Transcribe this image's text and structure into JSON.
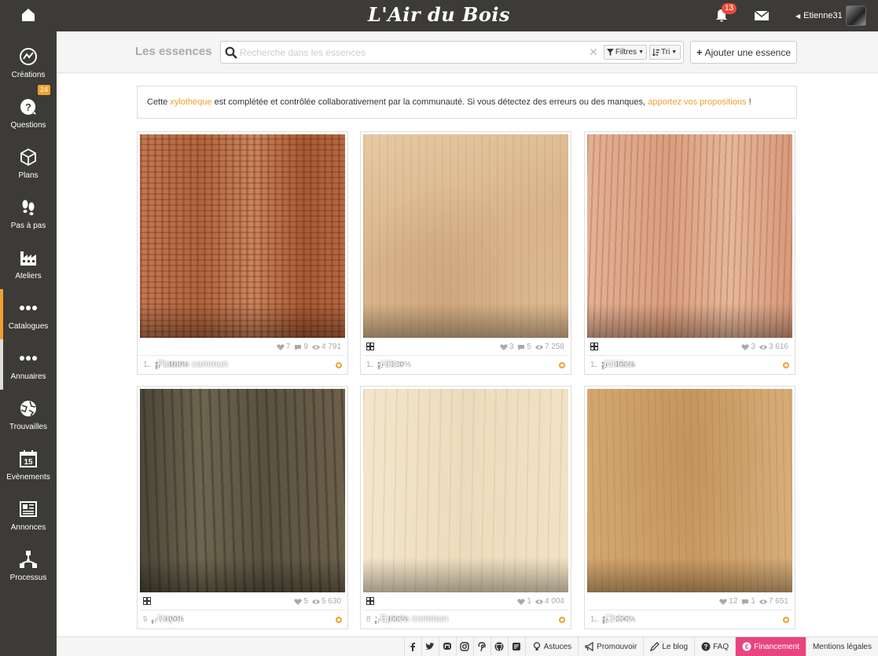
{
  "header": {
    "logo": "L'Air du Bois",
    "notifications_count": "13",
    "username": "Etienne31"
  },
  "sidebar": {
    "items": [
      {
        "label": "Créations",
        "icon": "creations-icon"
      },
      {
        "label": "Questions",
        "icon": "question-icon",
        "badge": "24"
      },
      {
        "label": "Plans",
        "icon": "cube-icon"
      },
      {
        "label": "Pas à pas",
        "icon": "footsteps-icon"
      },
      {
        "label": "Ateliers",
        "icon": "factory-icon"
      },
      {
        "label": "Catalogues",
        "icon": "dots-icon"
      },
      {
        "label": "Annuaires",
        "icon": "dots-icon"
      },
      {
        "label": "Trouvailles",
        "icon": "globe-icon"
      },
      {
        "label": "Evènements",
        "icon": "calendar-icon",
        "calendar_day": "15"
      },
      {
        "label": "Annonces",
        "icon": "newspaper-icon"
      },
      {
        "label": "Processus",
        "icon": "workflow-icon"
      }
    ]
  },
  "toolbar": {
    "title": "Les essences",
    "search_placeholder": "Recherche dans les essences",
    "filters_label": "Filtres",
    "sort_label": "Tri",
    "add_label": "Ajouter une essence"
  },
  "info": {
    "text_before": "Cette ",
    "link1": "xylothèque",
    "text_middle": " est complétée et contrôlée collaborativement par la communauté. Si vous détectez des erreurs ou des manques, ",
    "link2": "apportez vos propositions",
    "text_after": " !"
  },
  "cards": [
    {
      "name": "Platane commun",
      "tree": "deciduous",
      "likes": "7",
      "comments": "9",
      "views": "4 791",
      "has_grid": false,
      "count": "13",
      "percent": "100%",
      "texture": "platane"
    },
    {
      "name": "Hêtre",
      "tree": "deciduous",
      "likes": "3",
      "comments": "5",
      "views": "7 258",
      "has_grid": true,
      "count": "11",
      "percent": "100%",
      "texture": "hetre"
    },
    {
      "name": "Mélèze",
      "tree": "conifer",
      "likes": "3",
      "comments": "",
      "views": "3 616",
      "has_grid": true,
      "count": "11",
      "percent": "100%",
      "texture": "meleze"
    },
    {
      "name": "Noyer",
      "tree": "deciduous",
      "likes": "5",
      "comments": "",
      "views": "5 630",
      "has_grid": true,
      "count": "9",
      "percent": "100%",
      "texture": "noyer"
    },
    {
      "name": "Epicéa commun",
      "tree": "conifer",
      "likes": "1",
      "comments": "",
      "views": "4 004",
      "has_grid": true,
      "count": "8",
      "percent": "100%",
      "texture": "epicea"
    },
    {
      "name": "Chêne",
      "tree": "deciduous",
      "likes": "12",
      "comments": "1",
      "views": "7 651",
      "has_grid": false,
      "count": "12",
      "percent": "100%",
      "texture": "chene"
    }
  ],
  "footer": {
    "social": [
      "facebook-icon",
      "twitter-icon",
      "mastodon-icon",
      "instagram-icon",
      "pinterest-icon",
      "github-icon",
      "blog-icon"
    ],
    "links": [
      {
        "label": "Astuces",
        "icon": "bulb-icon"
      },
      {
        "label": "Promouvoir",
        "icon": "megaphone-icon"
      },
      {
        "label": "Le blog",
        "icon": "pen-icon"
      },
      {
        "label": "FAQ",
        "icon": "help-icon"
      },
      {
        "label": "Financement",
        "icon": "euro-icon"
      },
      {
        "label": "Mentions légales",
        "icon": ""
      }
    ]
  },
  "colors": {
    "accent": "#f0a030",
    "dark": "#3c3b37",
    "funding": "#e8457f",
    "badge": "#e74c3c"
  }
}
